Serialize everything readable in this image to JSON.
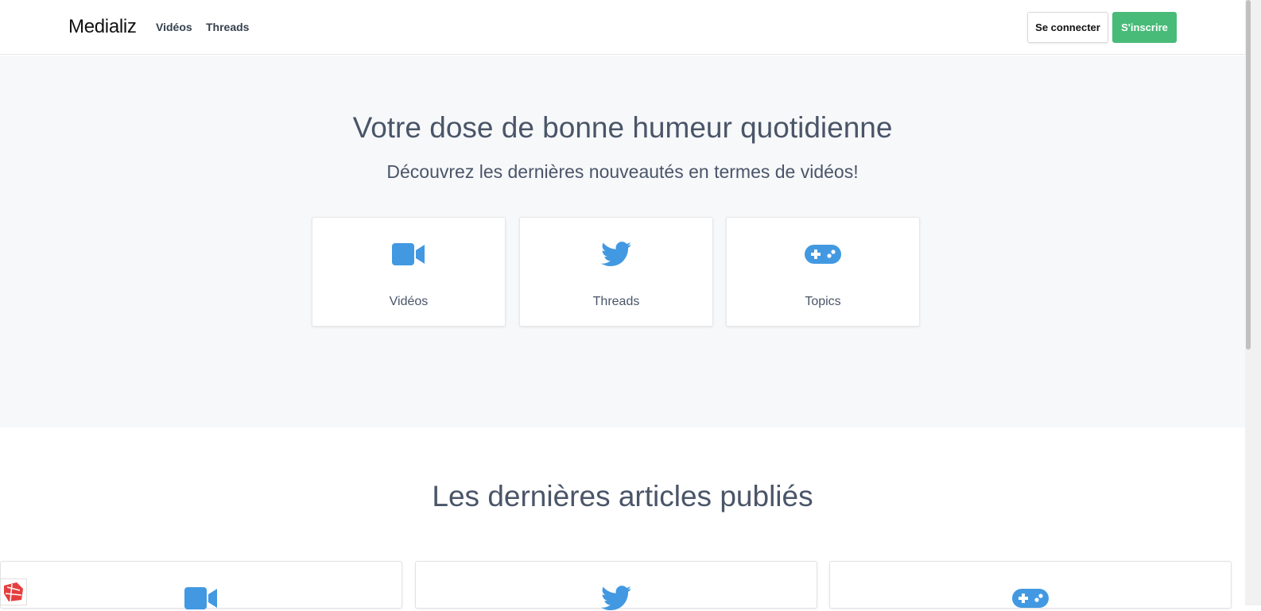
{
  "navbar": {
    "brand": "Medializ",
    "links": [
      {
        "label": "Vidéos"
      },
      {
        "label": "Threads"
      }
    ],
    "login_label": "Se connecter",
    "signup_label": "S'inscrire"
  },
  "hero": {
    "title": "Votre dose de bonne humeur quotidienne",
    "subtitle": "Découvrez les dernières nouveautés en termes de vidéos!",
    "cards": [
      {
        "label": "Vidéos",
        "icon": "video-camera-icon"
      },
      {
        "label": "Threads",
        "icon": "twitter-bird-icon"
      },
      {
        "label": "Topics",
        "icon": "gamepad-icon"
      }
    ]
  },
  "articles": {
    "title": "Les dernières articles publiés",
    "items": [
      {
        "icon": "video-camera-icon"
      },
      {
        "icon": "twitter-bird-icon"
      },
      {
        "icon": "gamepad-icon"
      }
    ]
  },
  "colors": {
    "accent_blue": "#4299e1",
    "signup_green": "#48bb78",
    "text": "#4a5568",
    "hero_bg": "#f7f8fa"
  }
}
